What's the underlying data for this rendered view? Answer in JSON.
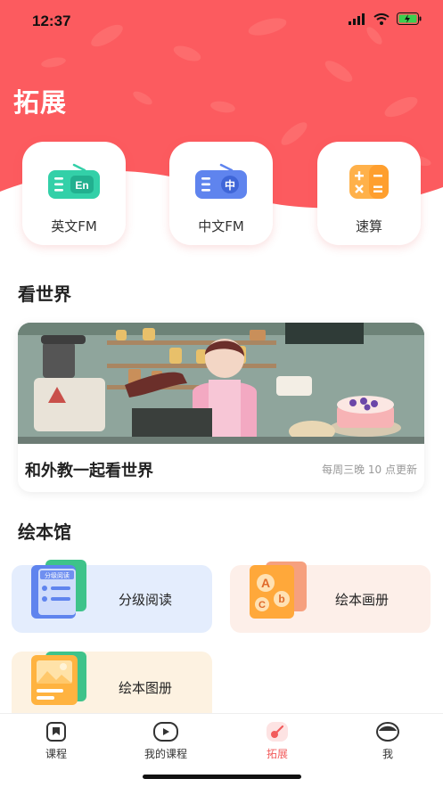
{
  "status_bar": {
    "time": "12:37"
  },
  "header": {
    "title": "拓展"
  },
  "quick_entries": [
    {
      "label": "英文FM",
      "badge": "En",
      "color": "#33d0a8"
    },
    {
      "label": "中文FM",
      "badge": "中",
      "color": "#5f84ee"
    },
    {
      "label": "速算",
      "badge": "",
      "color": "#ffb14a"
    }
  ],
  "world": {
    "section_title": "看世界",
    "banner_title": "和外教一起看世界",
    "banner_subtitle": "每周三晚 10 点更新"
  },
  "picture_books": {
    "section_title": "绘本馆",
    "cards": [
      {
        "label": "分级阅读",
        "bg": "#e4edfd",
        "cover_text": "分级阅读"
      },
      {
        "label": "绘本画册",
        "bg": "#fdefe9"
      },
      {
        "label": "绘本图册",
        "bg": "#fdf2e1"
      }
    ]
  },
  "tabbar": {
    "tabs": [
      {
        "label": "课程"
      },
      {
        "label": "我的课程"
      },
      {
        "label": "拓展"
      },
      {
        "label": "我"
      }
    ],
    "active_color": "#f25c5c"
  },
  "colors": {
    "brand": "#fc5b5f"
  }
}
